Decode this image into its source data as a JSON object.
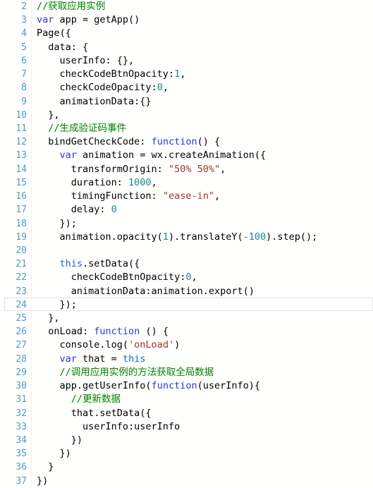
{
  "editor": {
    "name": "code-editor",
    "language": "javascript",
    "first_line_number": 2,
    "last_line_number": 37,
    "current_line": 24,
    "colors": {
      "background": "#fffffe",
      "line_number": "#4e9bc0",
      "comment": "#008000",
      "keyword": "#3333cc",
      "keyword_this": "#1565d8",
      "function": "#2a36d8",
      "string": "#a0342c",
      "number": "#1a8a8a",
      "plain": "#000000",
      "current_line_border": "#e2e2e2",
      "gutter_rule": "#f0f0f0"
    },
    "lines": [
      {
        "n": "2",
        "indent": 0,
        "tokens": [
          {
            "t": "cmt",
            "v": "//获取应用实例"
          }
        ]
      },
      {
        "n": "3",
        "indent": 0,
        "tokens": [
          {
            "t": "kw",
            "v": "var"
          },
          {
            "t": "pln",
            "v": " app = getApp()"
          }
        ]
      },
      {
        "n": "4",
        "indent": 0,
        "tokens": [
          {
            "t": "pln",
            "v": "Page({"
          }
        ]
      },
      {
        "n": "5",
        "indent": 0,
        "tokens": [
          {
            "t": "pln",
            "v": "  data: {"
          }
        ]
      },
      {
        "n": "6",
        "indent": 0,
        "tokens": [
          {
            "t": "pln",
            "v": "    userInfo: {},"
          }
        ]
      },
      {
        "n": "7",
        "indent": 0,
        "tokens": [
          {
            "t": "pln",
            "v": "    checkCodeBtnOpacity:"
          },
          {
            "t": "num",
            "v": "1"
          },
          {
            "t": "pln",
            "v": ","
          }
        ]
      },
      {
        "n": "8",
        "indent": 0,
        "tokens": [
          {
            "t": "pln",
            "v": "    checkCodeOpacity:"
          },
          {
            "t": "num",
            "v": "0"
          },
          {
            "t": "pln",
            "v": ","
          }
        ]
      },
      {
        "n": "9",
        "indent": 0,
        "tokens": [
          {
            "t": "pln",
            "v": "    animationData:{}"
          }
        ]
      },
      {
        "n": "10",
        "indent": 0,
        "tokens": [
          {
            "t": "pln",
            "v": "  },"
          }
        ]
      },
      {
        "n": "11",
        "indent": 0,
        "tokens": [
          {
            "t": "pln",
            "v": "  "
          },
          {
            "t": "cmt",
            "v": "//生成验证码事件"
          }
        ]
      },
      {
        "n": "12",
        "indent": 0,
        "tokens": [
          {
            "t": "pln",
            "v": "  bindGetCheckCode: "
          },
          {
            "t": "fn",
            "v": "function"
          },
          {
            "t": "pln",
            "v": "() {"
          }
        ]
      },
      {
        "n": "13",
        "indent": 0,
        "tokens": [
          {
            "t": "pln",
            "v": "    "
          },
          {
            "t": "kw",
            "v": "var"
          },
          {
            "t": "pln",
            "v": " animation = wx.createAnimation({"
          }
        ]
      },
      {
        "n": "14",
        "indent": 0,
        "tokens": [
          {
            "t": "pln",
            "v": "      transformOrigin: "
          },
          {
            "t": "str",
            "v": "\"50% 50%\""
          },
          {
            "t": "pln",
            "v": ","
          }
        ]
      },
      {
        "n": "15",
        "indent": 0,
        "tokens": [
          {
            "t": "pln",
            "v": "      duration: "
          },
          {
            "t": "num",
            "v": "1000"
          },
          {
            "t": "pln",
            "v": ","
          }
        ]
      },
      {
        "n": "16",
        "indent": 0,
        "tokens": [
          {
            "t": "pln",
            "v": "      timingFunction: "
          },
          {
            "t": "str",
            "v": "\"ease-in\""
          },
          {
            "t": "pln",
            "v": ","
          }
        ]
      },
      {
        "n": "17",
        "indent": 0,
        "tokens": [
          {
            "t": "pln",
            "v": "      delay: "
          },
          {
            "t": "num",
            "v": "0"
          }
        ]
      },
      {
        "n": "18",
        "indent": 0,
        "tokens": [
          {
            "t": "pln",
            "v": "    });"
          }
        ]
      },
      {
        "n": "19",
        "indent": 0,
        "tokens": [
          {
            "t": "pln",
            "v": "    animation.opacity("
          },
          {
            "t": "num",
            "v": "1"
          },
          {
            "t": "pln",
            "v": ").translateY("
          },
          {
            "t": "num",
            "v": "-100"
          },
          {
            "t": "pln",
            "v": ").step();"
          }
        ]
      },
      {
        "n": "20",
        "indent": 0,
        "tokens": [
          {
            "t": "pln",
            "v": ""
          }
        ]
      },
      {
        "n": "21",
        "indent": 0,
        "tokens": [
          {
            "t": "pln",
            "v": "    "
          },
          {
            "t": "kw2",
            "v": "this"
          },
          {
            "t": "pln",
            "v": ".setData({"
          }
        ]
      },
      {
        "n": "22",
        "indent": 0,
        "tokens": [
          {
            "t": "pln",
            "v": "      checkCodeBtnOpacity:"
          },
          {
            "t": "num",
            "v": "0"
          },
          {
            "t": "pln",
            "v": ","
          }
        ]
      },
      {
        "n": "23",
        "indent": 0,
        "tokens": [
          {
            "t": "pln",
            "v": "      animationData:animation.export()"
          }
        ]
      },
      {
        "n": "24",
        "indent": 0,
        "current": true,
        "tokens": [
          {
            "t": "pln",
            "v": "    });"
          }
        ]
      },
      {
        "n": "25",
        "indent": 0,
        "tokens": [
          {
            "t": "pln",
            "v": "  },"
          }
        ]
      },
      {
        "n": "26",
        "indent": 0,
        "tokens": [
          {
            "t": "pln",
            "v": "  onLoad: "
          },
          {
            "t": "fn",
            "v": "function"
          },
          {
            "t": "pln",
            "v": " () {"
          }
        ]
      },
      {
        "n": "27",
        "indent": 0,
        "tokens": [
          {
            "t": "pln",
            "v": "    console.log("
          },
          {
            "t": "str",
            "v": "'onLoad'"
          },
          {
            "t": "pln",
            "v": ")"
          }
        ]
      },
      {
        "n": "28",
        "indent": 0,
        "tokens": [
          {
            "t": "pln",
            "v": "    "
          },
          {
            "t": "kw",
            "v": "var"
          },
          {
            "t": "pln",
            "v": " that = "
          },
          {
            "t": "kw2",
            "v": "this"
          }
        ]
      },
      {
        "n": "29",
        "indent": 0,
        "tokens": [
          {
            "t": "pln",
            "v": "    "
          },
          {
            "t": "cmt",
            "v": "//调用应用实例的方法获取全局数据"
          }
        ]
      },
      {
        "n": "30",
        "indent": 0,
        "tokens": [
          {
            "t": "pln",
            "v": "    app.getUserInfo("
          },
          {
            "t": "fn",
            "v": "function"
          },
          {
            "t": "pln",
            "v": "(userInfo){"
          }
        ]
      },
      {
        "n": "31",
        "indent": 0,
        "tokens": [
          {
            "t": "pln",
            "v": "      "
          },
          {
            "t": "cmt",
            "v": "//更新数据"
          }
        ]
      },
      {
        "n": "32",
        "indent": 0,
        "tokens": [
          {
            "t": "pln",
            "v": "      that.setData({"
          }
        ]
      },
      {
        "n": "33",
        "indent": 0,
        "tokens": [
          {
            "t": "pln",
            "v": "        userInfo:userInfo"
          }
        ]
      },
      {
        "n": "34",
        "indent": 0,
        "tokens": [
          {
            "t": "pln",
            "v": "      })"
          }
        ]
      },
      {
        "n": "35",
        "indent": 0,
        "tokens": [
          {
            "t": "pln",
            "v": "    })"
          }
        ]
      },
      {
        "n": "36",
        "indent": 0,
        "tokens": [
          {
            "t": "pln",
            "v": "  }"
          }
        ]
      },
      {
        "n": "37",
        "indent": 0,
        "tokens": [
          {
            "t": "pln",
            "v": "})"
          }
        ]
      }
    ]
  }
}
